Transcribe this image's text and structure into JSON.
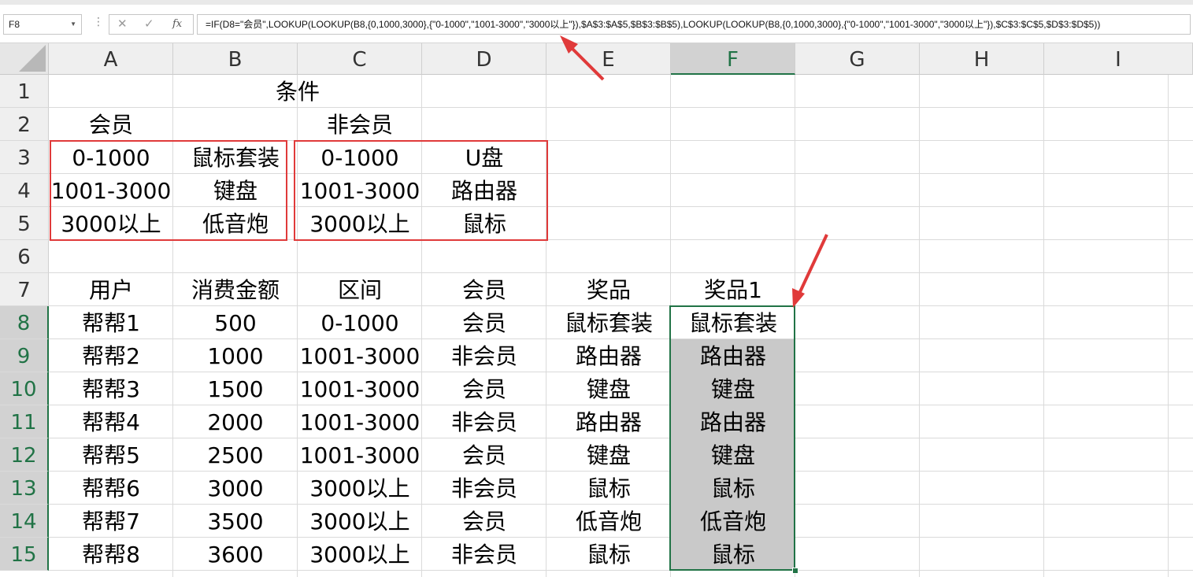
{
  "name_box": "F8",
  "formula_bar": {
    "cancel": "✕",
    "enter": "✓",
    "fx": "fx",
    "formula": "=IF(D8=\"会员\",LOOKUP(LOOKUP(B8,{0,1000,3000},{\"0-1000\",\"1001-3000\",\"3000以上\"}),$A$3:$A$5,$B$3:$B$5),LOOKUP(LOOKUP(B8,{0,1000,3000},{\"0-1000\",\"1001-3000\",\"3000以上\"}),$C$3:$C$5,$D$3:$D$5))"
  },
  "columns": [
    "A",
    "B",
    "C",
    "D",
    "E",
    "F",
    "G",
    "H",
    "I"
  ],
  "rows": [
    "1",
    "2",
    "3",
    "4",
    "5",
    "6",
    "7",
    "8",
    "9",
    "10",
    "11",
    "12",
    "13",
    "14",
    "15"
  ],
  "selected_column": "F",
  "sheet": {
    "title": "条件",
    "member_label": "会员",
    "nonmember_label": "非会员",
    "member_table": [
      [
        "0-1000",
        "鼠标套装"
      ],
      [
        "1001-3000",
        "键盘"
      ],
      [
        "3000以上",
        "低音炮"
      ]
    ],
    "nonmember_table": [
      [
        "0-1000",
        "U盘"
      ],
      [
        "1001-3000",
        "路由器"
      ],
      [
        "3000以上",
        "鼠标"
      ]
    ],
    "headers": [
      "用户",
      "消费金额",
      "区间",
      "会员",
      "奖品",
      "奖品1"
    ],
    "records": [
      [
        "帮帮1",
        "500",
        "0-1000",
        "会员",
        "鼠标套装",
        "鼠标套装"
      ],
      [
        "帮帮2",
        "1000",
        "1001-3000",
        "非会员",
        "路由器",
        "路由器"
      ],
      [
        "帮帮3",
        "1500",
        "1001-3000",
        "会员",
        "键盘",
        "键盘"
      ],
      [
        "帮帮4",
        "2000",
        "1001-3000",
        "非会员",
        "路由器",
        "路由器"
      ],
      [
        "帮帮5",
        "2500",
        "1001-3000",
        "会员",
        "键盘",
        "键盘"
      ],
      [
        "帮帮6",
        "3000",
        "3000以上",
        "非会员",
        "鼠标",
        "鼠标"
      ],
      [
        "帮帮7",
        "3500",
        "3000以上",
        "会员",
        "低音炮",
        "低音炮"
      ],
      [
        "帮帮8",
        "3600",
        "3000以上",
        "非会员",
        "鼠标",
        "鼠标"
      ]
    ]
  },
  "colors": {
    "accent": "#217346",
    "annotation": "#e03a3a",
    "selection_fill": "#c9c9c9"
  }
}
